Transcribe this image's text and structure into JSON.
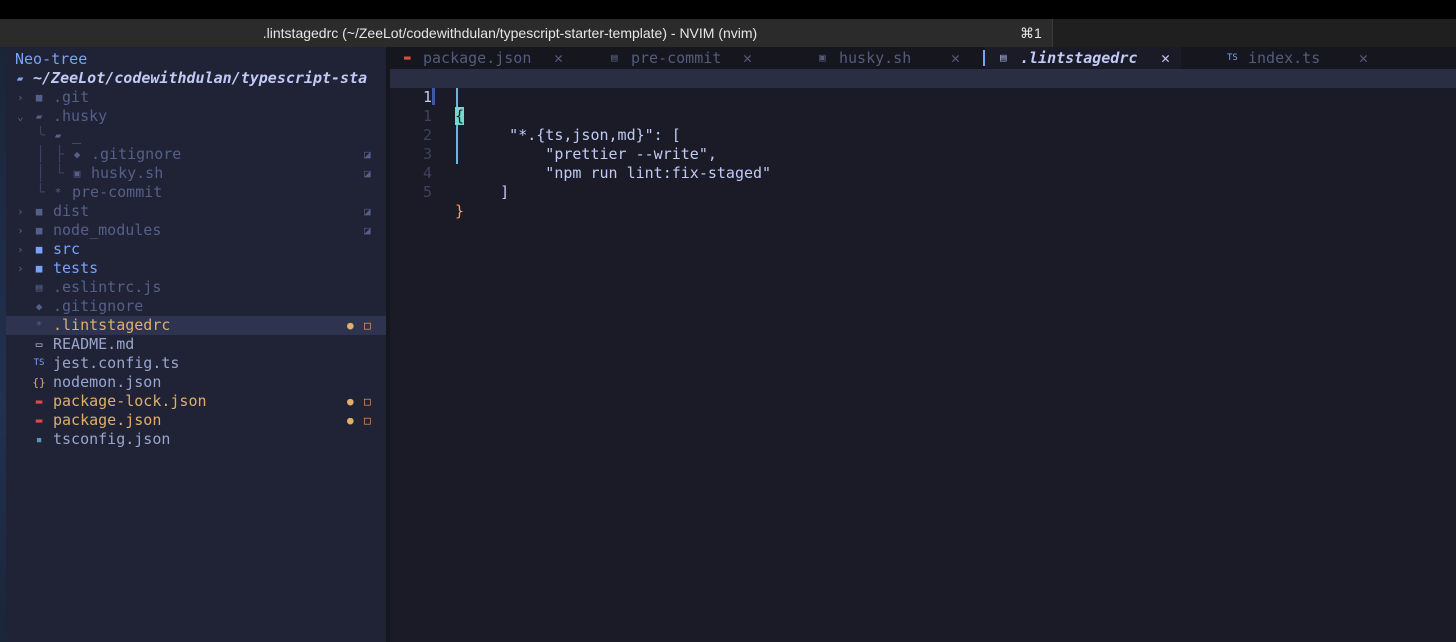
{
  "window": {
    "title": ".lintstagedrc (~/ZeeLot/codewithdulan/typescript-starter-template) - NVIM (nvim)",
    "shortcut": "⌘1"
  },
  "sidebar": {
    "title": "Neo-tree",
    "root_path": "~/ZeeLot/codewithdulan/typescript-sta",
    "items": [
      {
        "label": ".git",
        "icon": "folder-icon"
      },
      {
        "label": ".husky",
        "icon": "folder-open-icon"
      },
      {
        "label": "_",
        "icon": "folder-open-icon"
      },
      {
        "label": ".gitignore",
        "icon": "git-icon"
      },
      {
        "label": "husky.sh",
        "icon": "terminal-icon"
      },
      {
        "label": "pre-commit",
        "icon": "asterisk-icon"
      },
      {
        "label": "dist",
        "icon": "folder-icon"
      },
      {
        "label": "node_modules",
        "icon": "folder-icon"
      },
      {
        "label": "src",
        "icon": "folder-icon"
      },
      {
        "label": "tests",
        "icon": "folder-icon"
      },
      {
        "label": ".eslintrc.js",
        "icon": "eslint-icon"
      },
      {
        "label": ".gitignore",
        "icon": "git-icon"
      },
      {
        "label": ".lintstagedrc",
        "icon": "asterisk-icon"
      },
      {
        "label": "README.md",
        "icon": "markdown-icon"
      },
      {
        "label": "jest.config.ts",
        "icon": "typescript-icon"
      },
      {
        "label": "nodemon.json",
        "icon": "json-icon"
      },
      {
        "label": "package-lock.json",
        "icon": "npm-icon"
      },
      {
        "label": "package.json",
        "icon": "npm-icon"
      },
      {
        "label": "tsconfig.json",
        "icon": "tsconfig-icon"
      }
    ]
  },
  "tabs": [
    {
      "label": "package.json",
      "icon": "npm-icon",
      "active": false
    },
    {
      "label": "pre-commit",
      "icon": "file-icon",
      "active": false
    },
    {
      "label": "husky.sh",
      "icon": "terminal-icon",
      "active": false
    },
    {
      "label": ".lintstagedrc",
      "icon": "file-icon",
      "active": true
    },
    {
      "label": "index.ts",
      "icon": "typescript-icon",
      "active": false
    }
  ],
  "editor": {
    "lines": [
      {
        "number": "1",
        "open_brace": "{",
        "text": ""
      },
      {
        "number": "1",
        "text": "      \"*.{ts,json,md}\": ["
      },
      {
        "number": "2",
        "text": "          \"prettier --write\","
      },
      {
        "number": "3",
        "text": "          \"npm run lint:fix-staged\""
      },
      {
        "number": "4",
        "text": "     ]"
      },
      {
        "number": "5",
        "close_brace": "}",
        "text": ""
      }
    ]
  },
  "colors": {
    "bg": "#1a1b26",
    "sidebar_bg": "#1f2335",
    "accent": "#7aa2f7",
    "modified": "#e0af68",
    "cursor": "#73daca",
    "closing_brace": "#ff9e64"
  }
}
